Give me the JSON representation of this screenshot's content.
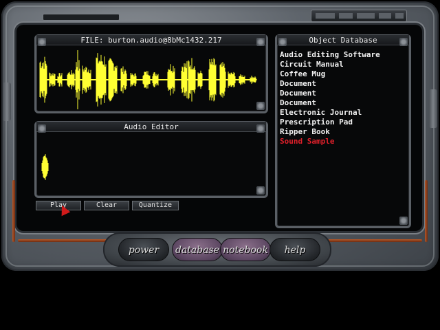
{
  "file_panel": {
    "title": "FILE: burton.audio@8bMc1432.217"
  },
  "editor_panel": {
    "title": "Audio Editor",
    "buttons": {
      "play": "Play",
      "clear": "Clear",
      "quantize": "Quantize"
    }
  },
  "object_database": {
    "title": "Object Database",
    "items": [
      {
        "label": "Audio Editing Software",
        "selected": false
      },
      {
        "label": "Circuit Manual",
        "selected": false
      },
      {
        "label": "Coffee Mug",
        "selected": false
      },
      {
        "label": "Document",
        "selected": false
      },
      {
        "label": "Document",
        "selected": false
      },
      {
        "label": "Document",
        "selected": false
      },
      {
        "label": "Electronic Journal",
        "selected": false
      },
      {
        "label": "Prescription Pad",
        "selected": false
      },
      {
        "label": "Ripper Book",
        "selected": false
      },
      {
        "label": "Sound Sample",
        "selected": true
      }
    ]
  },
  "nav": {
    "power": "power",
    "database": "database",
    "notebook": "notebook",
    "help": "help"
  },
  "colors": {
    "waveform": "#ffff33",
    "selected_item": "#e0202a",
    "cursor": "#d11a1a"
  },
  "icons": {
    "cursor": "arrow-cursor-icon"
  }
}
